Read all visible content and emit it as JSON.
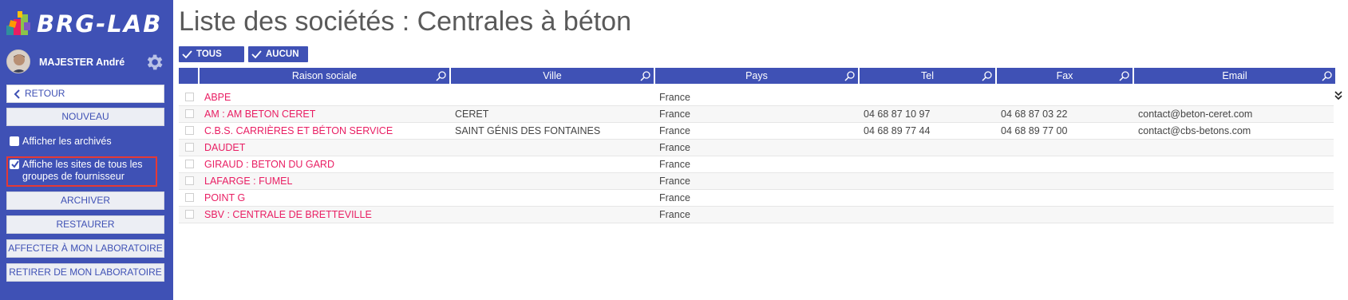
{
  "app": {
    "logo_text": "BRG-LAB"
  },
  "user": {
    "name": "MAJESTER André"
  },
  "sidebar": {
    "back_label": "RETOUR",
    "new_label": "NOUVEAU",
    "show_archives_label": "Afficher les archivés",
    "show_sites_label_line1": "Affiche les sites de tous les",
    "show_sites_label_line2": "groupes de fournisseur",
    "archive_label": "ARCHIVER",
    "restore_label": "RESTAURER",
    "assign_label": "AFFECTER À MON LABORATOIRE",
    "remove_label": "RETIRER DE MON LABORATOIRE"
  },
  "main": {
    "title": "Liste des sociétés : Centrales à béton",
    "all_label": "TOUS",
    "none_label": "AUCUN"
  },
  "table": {
    "columns": [
      "Raison sociale",
      "Ville",
      "Pays",
      "Tel",
      "Fax",
      "Email"
    ],
    "rows": [
      {
        "name": "ABPE",
        "city": "",
        "country": "France",
        "tel": "",
        "fax": "",
        "email": ""
      },
      {
        "name": "AM : AM BETON CERET",
        "city": "CERET",
        "country": "France",
        "tel": "04 68 87 10 97",
        "fax": "04 68 87 03 22",
        "email": "contact@beton-ceret.com"
      },
      {
        "name": "C.B.S. CARRIÈRES ET BÉTON SERVICE",
        "city": "SAINT GÉNIS DES FONTAINES",
        "country": "France",
        "tel": "04 68 89 77 44",
        "fax": "04 68 89 77 00",
        "email": "contact@cbs-betons.com"
      },
      {
        "name": "DAUDET",
        "city": "",
        "country": "France",
        "tel": "",
        "fax": "",
        "email": ""
      },
      {
        "name": "GIRAUD : BETON DU GARD",
        "city": "",
        "country": "France",
        "tel": "",
        "fax": "",
        "email": ""
      },
      {
        "name": "LAFARGE : FUMEL",
        "city": "",
        "country": "France",
        "tel": "",
        "fax": "",
        "email": ""
      },
      {
        "name": "POINT G",
        "city": "",
        "country": "France",
        "tel": "",
        "fax": "",
        "email": ""
      },
      {
        "name": "SBV : CENTRALE DE BRETTEVILLE",
        "city": "",
        "country": "France",
        "tel": "",
        "fax": "",
        "email": ""
      }
    ]
  },
  "colors": {
    "sidebar_bg": "#3f51b5",
    "accent": "#3f51b5",
    "link_pink": "#e91e63",
    "highlight_red": "#e53935"
  },
  "icons": [
    "logo-icon",
    "avatar",
    "gear-icon",
    "chevron-left-icon",
    "check-icon",
    "search-icon",
    "chevron-double-down-icon"
  ]
}
